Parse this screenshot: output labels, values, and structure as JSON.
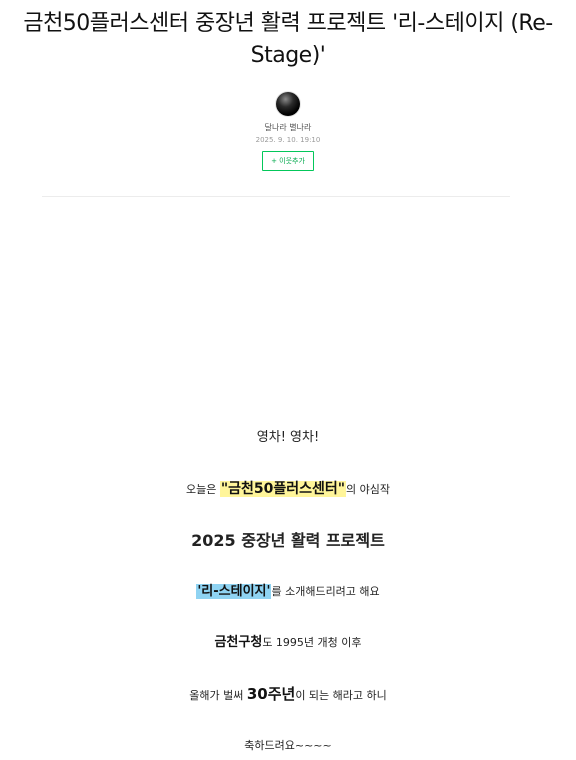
{
  "post": {
    "title": "금천50플러스센터 중장년 활력 프로젝트 '리-스테이지 (Re-Stage)'",
    "author": "달나라 별나라",
    "date": "2025. 9. 10. 19:10",
    "neighbor_button": "+ 이웃추가"
  },
  "content": {
    "line1": "영차! 영차!",
    "line2_prefix": "오늘은 ",
    "line2_highlight": "\"금천50플러스센터\"",
    "line2_suffix": "의 야심작",
    "line3": "2025 중장년 활력 프로젝트",
    "line4_highlight": "'리-스테이지'",
    "line4_suffix": "를 소개해드리려고 해요",
    "line5_strong": "금천구청",
    "line5_rest": "도 1995년 개청 이후",
    "line6_prefix": "올해가 벌써 ",
    "line6_strong": "30주년",
    "line6_suffix": "이 되는 해라고 하니",
    "line7": "축하드려요~~~~"
  },
  "colors": {
    "highlight_yellow": "#fff59a",
    "highlight_blue": "#8fd3f2",
    "neighbor_green": "#03c75a"
  },
  "icons": {
    "avatar": "profile-avatar"
  }
}
